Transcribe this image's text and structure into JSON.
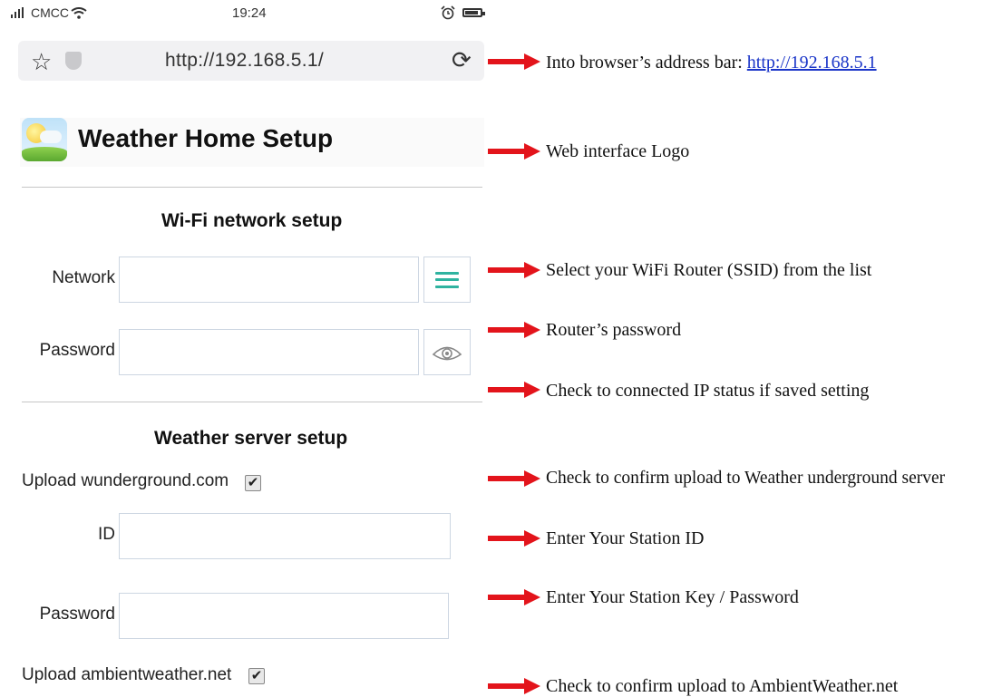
{
  "status_bar": {
    "carrier": "CMCC",
    "time": "19:24",
    "icons": [
      "signal-icon",
      "wifi-icon",
      "alarm-icon",
      "battery-icon"
    ]
  },
  "browser": {
    "url": "http://192.168.5.1/",
    "icons": [
      "star-icon",
      "shield-icon",
      "reload-icon"
    ]
  },
  "header": {
    "title": "Weather Home Setup",
    "logo_icon": "weather-logo-icon"
  },
  "wifi_setup": {
    "title": "Wi-Fi network setup",
    "network_label": "Network",
    "network_value": "",
    "password_label": "Password",
    "password_value": "",
    "icons": [
      "menu-list-icon",
      "eye-icon"
    ]
  },
  "weather_server": {
    "title": "Weather server setup",
    "wunderground_label": "Upload wunderground.com",
    "wunderground_checked": true,
    "id_label": "ID",
    "id_value": "",
    "password_label": "Password",
    "password_value": "",
    "ambient_label": "Upload ambientweather.net",
    "ambient_checked": true,
    "checkmark": "✔"
  },
  "annotations": {
    "address_bar_text": "Into browser’s address bar: ",
    "address_bar_link": "http://192.168.5.1",
    "logo": "Web interface Logo",
    "select_router": "Select your WiFi Router (SSID) from the list",
    "router_password": "Router’s password",
    "ip_status": "Check to connected IP status if saved setting",
    "confirm_wunderground": "Check to confirm upload to Weather underground server",
    "station_id": "Enter Your Station ID",
    "station_key": "Enter Your Station Key / Password",
    "confirm_ambient": "Check to confirm upload to AmbientWeather.net"
  },
  "colors": {
    "arrow": "#e3141b",
    "menu_icon": "#2fb3a0",
    "link": "#1a35c8"
  }
}
